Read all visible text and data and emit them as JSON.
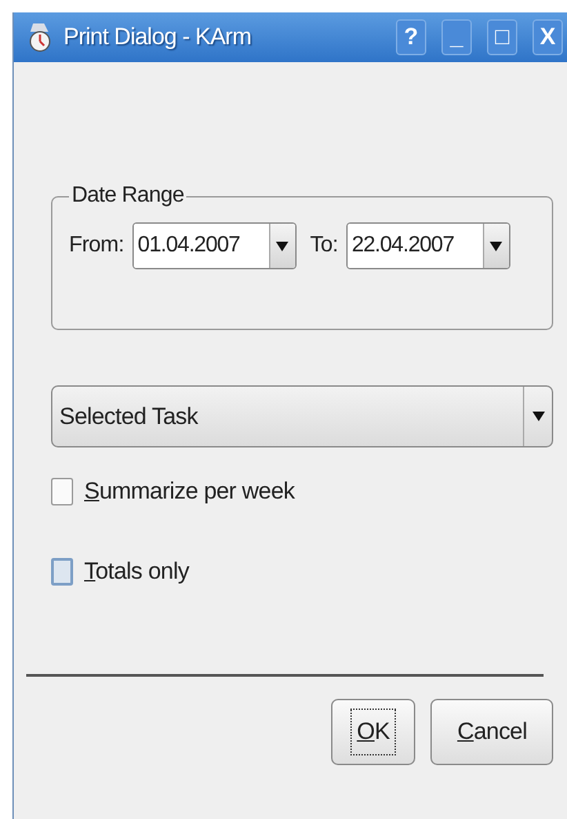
{
  "window": {
    "title": "Print Dialog - KArm",
    "title_buttons": [
      "?",
      "_",
      "□",
      "X"
    ]
  },
  "date_range": {
    "title": "Date Range",
    "from_label": "From:",
    "from_value": "01.04.2007",
    "to_label": "To:",
    "to_value": "22.04.2007"
  },
  "scope": {
    "value": "Selected Task"
  },
  "options": [
    {
      "label": "Summarize per week",
      "checked": false,
      "focused": false
    },
    {
      "label": "Totals only",
      "checked": false,
      "focused": true
    }
  ],
  "buttons": [
    {
      "label": "OK",
      "default": true
    },
    {
      "label": "Cancel",
      "default": false
    }
  ]
}
